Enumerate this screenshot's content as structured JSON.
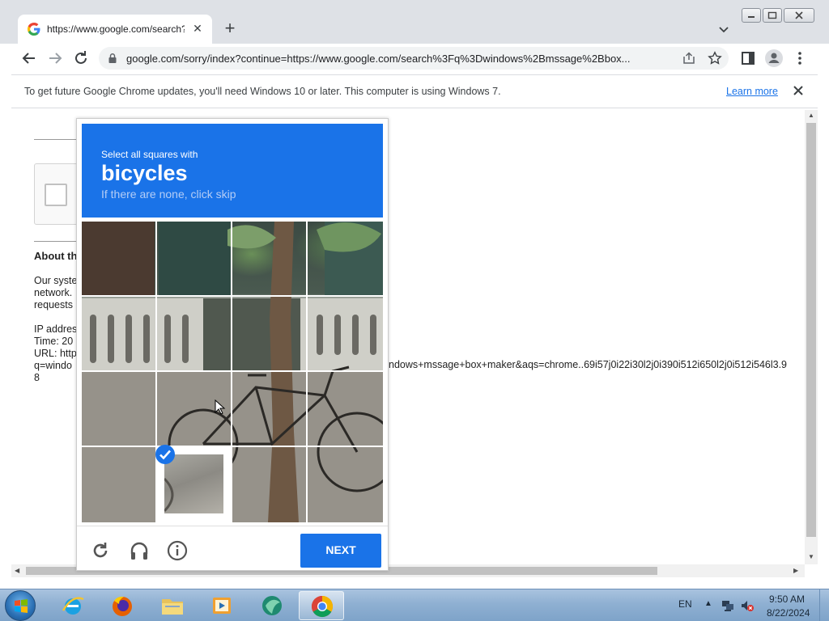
{
  "browser": {
    "tab_title": "https://www.google.com/search?",
    "url": "google.com/sorry/index?continue=https://www.google.com/search%3Fq%3Dwindows%2Bmssage%2Bbox..."
  },
  "infobar": {
    "message": "To get future Google Chrome updates, you'll need Windows 10 or later. This computer is using Windows 7.",
    "learn_more": "Learn more"
  },
  "page": {
    "about_heading": "About th",
    "body_lines": [
      "Our syste",
      "network.",
      "requests"
    ],
    "ip_line": "IP addres",
    "time_line": "Time: 20",
    "url_line": "URL: http",
    "q_line": "q=windo",
    "last_line": "8",
    "url_tail": "ndows+mssage+box+maker&aqs=chrome..69i57j0i22i30l2j0i390i512i650l2j0i512i546l3.9"
  },
  "challenge": {
    "instruction": "Select all squares with",
    "target": "bicycles",
    "hint": "If there are none, click skip",
    "selected_tiles": [
      14
    ],
    "next_label": "NEXT"
  },
  "taskbar": {
    "language": "EN",
    "time": "9:50 AM",
    "date": "8/22/2024"
  },
  "colors": {
    "accent": "#1a73e8",
    "taskbar": "#8fb0d2"
  },
  "icons": [
    "google-favicon",
    "close-icon",
    "plus-icon",
    "chevron-down-icon",
    "back-icon",
    "forward-icon",
    "reload-icon",
    "lock-icon",
    "share-icon",
    "star-icon",
    "side-panel-icon",
    "profile-icon",
    "menu-icon",
    "refresh-icon",
    "headphones-icon",
    "info-icon",
    "checkmark-icon",
    "windows-start-icon",
    "ie-icon",
    "firefox-icon",
    "explorer-icon",
    "media-icon",
    "app-icon",
    "chrome-icon",
    "network-icon",
    "volume-muted-icon"
  ]
}
